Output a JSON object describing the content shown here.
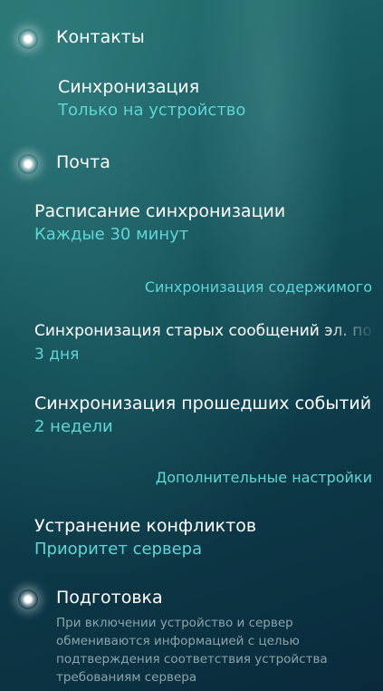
{
  "contacts": {
    "label": "Контакты",
    "sync_title": "Синхронизация",
    "sync_value": "Только на устройство"
  },
  "mail": {
    "label": "Почта",
    "schedule_title": "Расписание синхронизации",
    "schedule_value": "Каждые 30 минут"
  },
  "content_sync": {
    "header": "Синхронизация содержимого",
    "old_messages_title": "Синхронизация старых сообщений эл. почты",
    "old_messages_value": "3 дня",
    "past_events_title": "Синхронизация прошедших событий",
    "past_events_value": "2 недели"
  },
  "advanced": {
    "header": "Дополнительные настройки",
    "conflict_title": "Устранение конфликтов",
    "conflict_value": "Приоритет сервера"
  },
  "provisioning": {
    "label": "Подготовка",
    "description": "При включении устройство и сервер обмениваются информацией с целью подтверждения соответствия устройства требованиям сервера"
  },
  "colors": {
    "accent": "#5fd6d3",
    "text": "#ffffff",
    "background": "#14525a"
  }
}
